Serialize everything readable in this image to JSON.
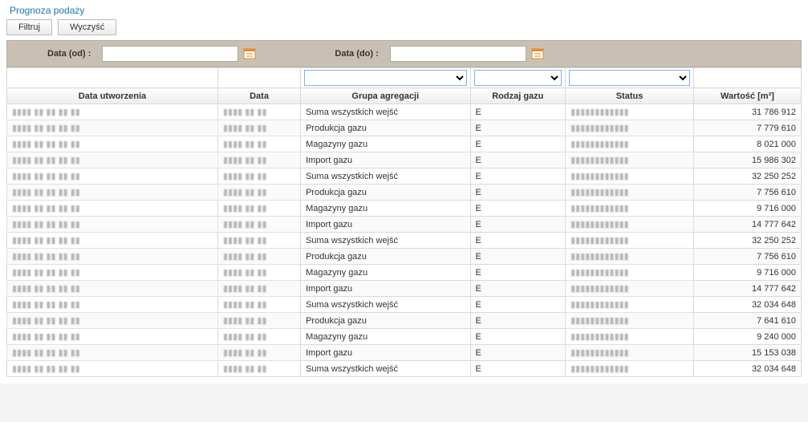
{
  "page_title": "Prognoza podaży",
  "toolbar": {
    "filter_label": "Filtruj",
    "clear_label": "Wyczyść"
  },
  "filters": {
    "date_from_label": "Data (od) :",
    "date_from_value": "",
    "date_to_label": "Data (do) :",
    "date_to_value": ""
  },
  "columns": {
    "created": "Data utworzenia",
    "date": "Data",
    "group": "Grupa agregacji",
    "gas_type": "Rodzaj gazu",
    "status": "Status",
    "value": "Wartość [m³]"
  },
  "rows": [
    {
      "created": "▮▮▮▮ ▮▮ ▮▮ ▮▮ ▮▮",
      "date": "▮▮▮▮ ▮▮ ▮▮",
      "group": "Suma wszystkich wejść",
      "type": "E",
      "status": "▮▮▮▮▮▮▮▮▮▮▮▮",
      "value": "31 786 912"
    },
    {
      "created": "▮▮▮▮ ▮▮ ▮▮ ▮▮ ▮▮",
      "date": "▮▮▮▮ ▮▮ ▮▮",
      "group": "Produkcja gazu",
      "type": "E",
      "status": "▮▮▮▮▮▮▮▮▮▮▮▮",
      "value": "7 779 610"
    },
    {
      "created": "▮▮▮▮ ▮▮ ▮▮ ▮▮ ▮▮",
      "date": "▮▮▮▮ ▮▮ ▮▮",
      "group": "Magazyny gazu",
      "type": "E",
      "status": "▮▮▮▮▮▮▮▮▮▮▮▮",
      "value": "8 021 000"
    },
    {
      "created": "▮▮▮▮ ▮▮ ▮▮ ▮▮ ▮▮",
      "date": "▮▮▮▮ ▮▮ ▮▮",
      "group": "Import gazu",
      "type": "E",
      "status": "▮▮▮▮▮▮▮▮▮▮▮▮",
      "value": "15 986 302"
    },
    {
      "created": "▮▮▮▮ ▮▮ ▮▮ ▮▮ ▮▮",
      "date": "▮▮▮▮ ▮▮ ▮▮",
      "group": "Suma wszystkich wejść",
      "type": "E",
      "status": "▮▮▮▮▮▮▮▮▮▮▮▮",
      "value": "32 250 252"
    },
    {
      "created": "▮▮▮▮ ▮▮ ▮▮ ▮▮ ▮▮",
      "date": "▮▮▮▮ ▮▮ ▮▮",
      "group": "Produkcja gazu",
      "type": "E",
      "status": "▮▮▮▮▮▮▮▮▮▮▮▮",
      "value": "7 756 610"
    },
    {
      "created": "▮▮▮▮ ▮▮ ▮▮ ▮▮ ▮▮",
      "date": "▮▮▮▮ ▮▮ ▮▮",
      "group": "Magazyny gazu",
      "type": "E",
      "status": "▮▮▮▮▮▮▮▮▮▮▮▮",
      "value": "9 716 000"
    },
    {
      "created": "▮▮▮▮ ▮▮ ▮▮ ▮▮ ▮▮",
      "date": "▮▮▮▮ ▮▮ ▮▮",
      "group": "Import gazu",
      "type": "E",
      "status": "▮▮▮▮▮▮▮▮▮▮▮▮",
      "value": "14 777 642"
    },
    {
      "created": "▮▮▮▮ ▮▮ ▮▮ ▮▮ ▮▮",
      "date": "▮▮▮▮ ▮▮ ▮▮",
      "group": "Suma wszystkich wejść",
      "type": "E",
      "status": "▮▮▮▮▮▮▮▮▮▮▮▮",
      "value": "32 250 252"
    },
    {
      "created": "▮▮▮▮ ▮▮ ▮▮ ▮▮ ▮▮",
      "date": "▮▮▮▮ ▮▮ ▮▮",
      "group": "Produkcja gazu",
      "type": "E",
      "status": "▮▮▮▮▮▮▮▮▮▮▮▮",
      "value": "7 756 610"
    },
    {
      "created": "▮▮▮▮ ▮▮ ▮▮ ▮▮ ▮▮",
      "date": "▮▮▮▮ ▮▮ ▮▮",
      "group": "Magazyny gazu",
      "type": "E",
      "status": "▮▮▮▮▮▮▮▮▮▮▮▮",
      "value": "9 716 000"
    },
    {
      "created": "▮▮▮▮ ▮▮ ▮▮ ▮▮ ▮▮",
      "date": "▮▮▮▮ ▮▮ ▮▮",
      "group": "Import gazu",
      "type": "E",
      "status": "▮▮▮▮▮▮▮▮▮▮▮▮",
      "value": "14 777 642"
    },
    {
      "created": "▮▮▮▮ ▮▮ ▮▮ ▮▮ ▮▮",
      "date": "▮▮▮▮ ▮▮ ▮▮",
      "group": "Suma wszystkich wejść",
      "type": "E",
      "status": "▮▮▮▮▮▮▮▮▮▮▮▮",
      "value": "32 034 648"
    },
    {
      "created": "▮▮▮▮ ▮▮ ▮▮ ▮▮ ▮▮",
      "date": "▮▮▮▮ ▮▮ ▮▮",
      "group": "Produkcja gazu",
      "type": "E",
      "status": "▮▮▮▮▮▮▮▮▮▮▮▮",
      "value": "7 641 610"
    },
    {
      "created": "▮▮▮▮ ▮▮ ▮▮ ▮▮ ▮▮",
      "date": "▮▮▮▮ ▮▮ ▮▮",
      "group": "Magazyny gazu",
      "type": "E",
      "status": "▮▮▮▮▮▮▮▮▮▮▮▮",
      "value": "9 240 000"
    },
    {
      "created": "▮▮▮▮ ▮▮ ▮▮ ▮▮ ▮▮",
      "date": "▮▮▮▮ ▮▮ ▮▮",
      "group": "Import gazu",
      "type": "E",
      "status": "▮▮▮▮▮▮▮▮▮▮▮▮",
      "value": "15 153 038"
    },
    {
      "created": "▮▮▮▮ ▮▮ ▮▮ ▮▮ ▮▮",
      "date": "▮▮▮▮ ▮▮ ▮▮",
      "group": "Suma wszystkich wejść",
      "type": "E",
      "status": "▮▮▮▮▮▮▮▮▮▮▮▮",
      "value": "32 034 648"
    }
  ]
}
